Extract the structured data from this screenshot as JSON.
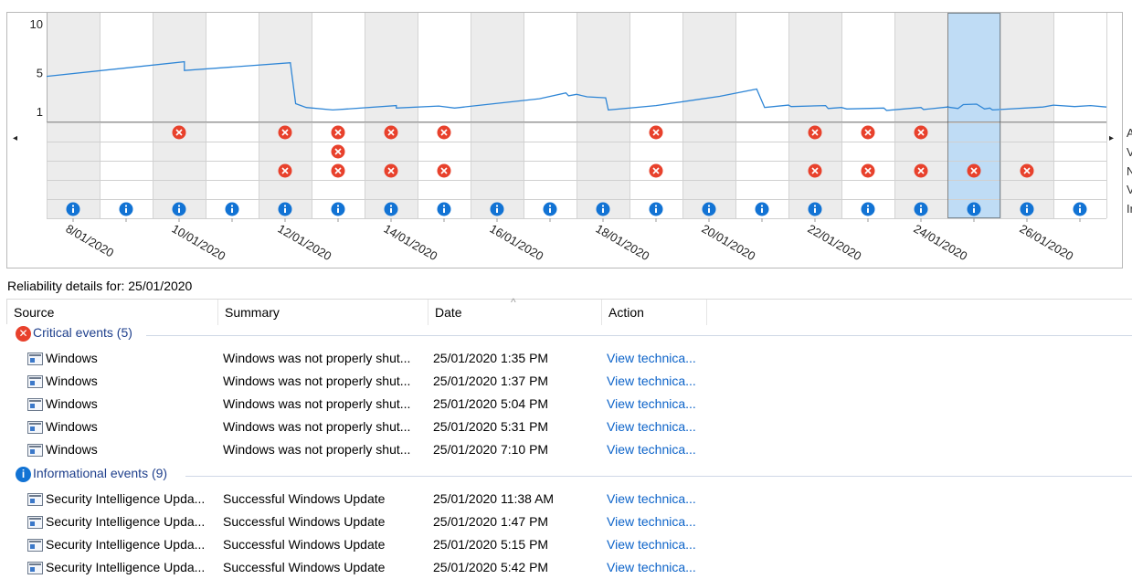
{
  "chart_data": {
    "type": "line",
    "ylim": [
      1,
      10
    ],
    "y_ticks": [
      "10",
      "5",
      "1"
    ],
    "x_labels": [
      "8/01/2020",
      "10/01/2020",
      "12/01/2020",
      "14/01/2020",
      "16/01/2020",
      "18/01/2020",
      "20/01/2020",
      "22/01/2020",
      "24/01/2020",
      "26/01/2020"
    ],
    "days": 20,
    "selected_day_index": 17,
    "stability_index": [
      [
        0,
        4.6
      ],
      [
        2.6,
        6.1
      ],
      [
        2.6,
        5.2
      ],
      [
        4.6,
        6.0
      ],
      [
        4.7,
        1.8
      ],
      [
        4.9,
        1.4
      ],
      [
        5.4,
        1.15
      ],
      [
        6.6,
        1.6
      ],
      [
        6.6,
        1.35
      ],
      [
        7.4,
        1.55
      ],
      [
        7.7,
        1.35
      ],
      [
        9.3,
        2.3
      ],
      [
        9.8,
        2.9
      ],
      [
        9.85,
        2.6
      ],
      [
        10.0,
        2.75
      ],
      [
        10.2,
        2.5
      ],
      [
        10.55,
        2.4
      ],
      [
        10.6,
        1.15
      ],
      [
        11.5,
        1.6
      ],
      [
        12.7,
        2.55
      ],
      [
        13.4,
        3.3
      ],
      [
        13.55,
        1.4
      ],
      [
        14.0,
        1.65
      ],
      [
        14.05,
        1.5
      ],
      [
        14.7,
        1.6
      ],
      [
        14.75,
        1.3
      ],
      [
        15.0,
        1.4
      ],
      [
        15.1,
        1.25
      ],
      [
        15.8,
        1.35
      ],
      [
        15.85,
        1.1
      ],
      [
        16.5,
        1.4
      ],
      [
        16.55,
        1.2
      ],
      [
        17.0,
        1.45
      ],
      [
        17.2,
        1.3
      ],
      [
        17.3,
        1.7
      ],
      [
        17.55,
        1.75
      ],
      [
        17.7,
        1.25
      ],
      [
        17.8,
        1.35
      ],
      [
        17.85,
        1.15
      ],
      [
        18.8,
        1.45
      ],
      [
        19.0,
        1.65
      ],
      [
        19.4,
        1.5
      ],
      [
        19.7,
        1.6
      ],
      [
        20,
        1.45
      ]
    ],
    "rows": [
      {
        "name": "Application failures",
        "type": "critical",
        "days": [
          2,
          4,
          5,
          6,
          7,
          11,
          14,
          15,
          16
        ]
      },
      {
        "name": "Windows failures",
        "type": "critical",
        "days": [
          5
        ]
      },
      {
        "name": "Miscellaneous failures",
        "type": "critical",
        "days": [
          4,
          5,
          6,
          7,
          11,
          14,
          15,
          16,
          17,
          18,
          20
        ]
      },
      {
        "name": "Warnings",
        "type": "warning",
        "days": []
      },
      {
        "name": "Information",
        "type": "info",
        "days": [
          0,
          1,
          2,
          3,
          4,
          5,
          6,
          7,
          8,
          9,
          10,
          11,
          12,
          13,
          14,
          15,
          16,
          17,
          18,
          19
        ]
      }
    ],
    "right_labels": [
      "A",
      "V",
      "N",
      "V",
      "Ir"
    ]
  },
  "nav": {
    "left_arrow": "◂",
    "right_arrow": "▸"
  },
  "details": {
    "title": "Reliability details for: 25/01/2020"
  },
  "columns": {
    "source": "Source",
    "summary": "Summary",
    "date": "Date",
    "action": "Action",
    "sort_caret": "^"
  },
  "groups": {
    "critical": {
      "label": "Critical events (5)",
      "icon": "critical-icon",
      "color": "#e8412c"
    },
    "informational": {
      "label": "Informational events (9)",
      "icon": "info-icon",
      "color": "#1273d4"
    }
  },
  "critical_events": [
    {
      "source": "Windows",
      "summary": "Windows was not properly shut...",
      "date": "25/01/2020 1:35 PM",
      "action": "View technica..."
    },
    {
      "source": "Windows",
      "summary": "Windows was not properly shut...",
      "date": "25/01/2020 1:37 PM",
      "action": "View technica..."
    },
    {
      "source": "Windows",
      "summary": "Windows was not properly shut...",
      "date": "25/01/2020 5:04 PM",
      "action": "View technica..."
    },
    {
      "source": "Windows",
      "summary": "Windows was not properly shut...",
      "date": "25/01/2020 5:31 PM",
      "action": "View technica..."
    },
    {
      "source": "Windows",
      "summary": "Windows was not properly shut...",
      "date": "25/01/2020 7:10 PM",
      "action": "View technica..."
    }
  ],
  "info_events": [
    {
      "source": "Security Intelligence Upda...",
      "summary": "Successful Windows Update",
      "date": "25/01/2020 11:38 AM",
      "action": "View technica..."
    },
    {
      "source": "Security Intelligence Upda...",
      "summary": "Successful Windows Update",
      "date": "25/01/2020 1:47 PM",
      "action": "View technica..."
    },
    {
      "source": "Security Intelligence Upda...",
      "summary": "Successful Windows Update",
      "date": "25/01/2020 5:15 PM",
      "action": "View technica..."
    },
    {
      "source": "Security Intelligence Upda...",
      "summary": "Successful Windows Update",
      "date": "25/01/2020 5:42 PM",
      "action": "View technica..."
    }
  ]
}
